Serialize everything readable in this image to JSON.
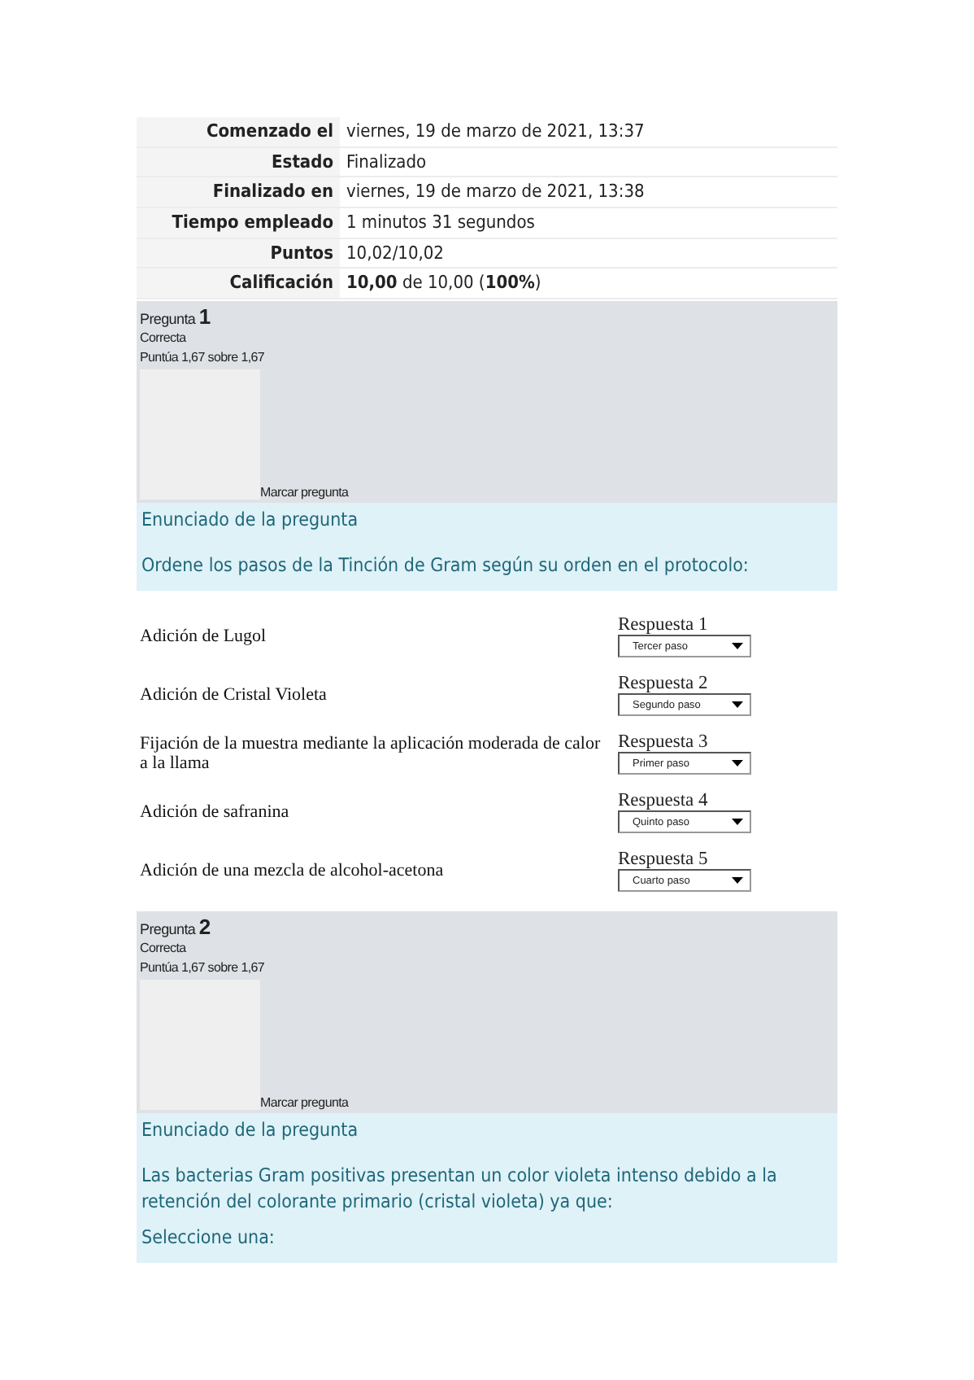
{
  "summary": [
    {
      "label": "Comenzado el",
      "value": "viernes, 19 de marzo de 2021, 13:37"
    },
    {
      "label": "Estado",
      "value": "Finalizado"
    },
    {
      "label": "Finalizado en",
      "value": "viernes, 19 de marzo de 2021, 13:38"
    },
    {
      "label": "Tiempo empleado",
      "value": "1 minutos 31 segundos"
    },
    {
      "label": "Puntos",
      "value": "10,02/10,02"
    },
    {
      "label": "Calificación",
      "value": "**10,00** de 10,00 (**100%**)"
    }
  ],
  "questions": [
    {
      "word": "Pregunta",
      "number": "1",
      "state": "Correcta",
      "grade": "Puntúa 1,67 sobre 1,67",
      "flag": "Marcar pregunta",
      "heading": "Enunciado de la pregunta",
      "texts": [
        "Ordene los pasos de la Tinción de Gram según su orden en el protocolo:"
      ],
      "matches": [
        {
          "item": "Adición de Lugol",
          "label": "Respuesta 1",
          "value": "Tercer paso"
        },
        {
          "item": "Adición de Cristal Violeta",
          "label": "Respuesta 2",
          "value": "Segundo paso"
        },
        {
          "item": "Fijación de la muestra mediante la aplicación moderada de calor a la llama",
          "label": "Respuesta 3",
          "value": "Primer paso"
        },
        {
          "item": "Adición de safranina",
          "label": "Respuesta 4",
          "value": "Quinto paso"
        },
        {
          "item": "Adición de una mezcla de alcohol-acetona",
          "label": "Respuesta 5",
          "value": "Cuarto paso"
        }
      ]
    },
    {
      "word": "Pregunta",
      "number": "2",
      "state": "Correcta",
      "grade": "Puntúa 1,67 sobre 1,67",
      "flag": "Marcar pregunta",
      "heading": "Enunciado de la pregunta",
      "texts": [
        "Las bacterias Gram positivas presentan un color violeta intenso debido a la retención del colorante primario (cristal violeta) ya que:",
        "Seleccione una:"
      ]
    }
  ]
}
